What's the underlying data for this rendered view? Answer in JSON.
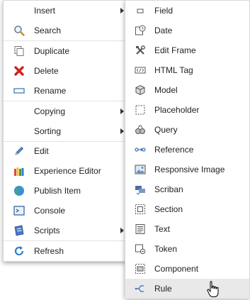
{
  "main_menu": {
    "items": [
      {
        "label": "Insert",
        "icon": "none",
        "submenu": true
      },
      {
        "label": "Search",
        "icon": "magnifier-icon",
        "submenu": false
      },
      {
        "label": "Duplicate",
        "icon": "duplicate-icon",
        "submenu": false
      },
      {
        "label": "Delete",
        "icon": "red-x-icon",
        "submenu": false
      },
      {
        "label": "Rename",
        "icon": "rename-field-icon",
        "submenu": false
      },
      {
        "label": "Copying",
        "icon": "none",
        "submenu": true
      },
      {
        "label": "Sorting",
        "icon": "none",
        "submenu": true
      },
      {
        "label": "Edit",
        "icon": "pencil-icon",
        "submenu": false
      },
      {
        "label": "Experience Editor",
        "icon": "crayons-icon",
        "submenu": false
      },
      {
        "label": "Publish Item",
        "icon": "globe-icon",
        "submenu": false
      },
      {
        "label": "Console",
        "icon": "console-icon",
        "submenu": false
      },
      {
        "label": "Scripts",
        "icon": "scripts-icon",
        "submenu": true
      },
      {
        "label": "Refresh",
        "icon": "refresh-icon",
        "submenu": false
      }
    ]
  },
  "sub_menu": {
    "items": [
      {
        "label": "Field",
        "icon": "field-icon"
      },
      {
        "label": "Date",
        "icon": "date-icon"
      },
      {
        "label": "Edit Frame",
        "icon": "tools-icon"
      },
      {
        "label": "HTML Tag",
        "icon": "html-tag-icon"
      },
      {
        "label": "Model",
        "icon": "cube-icon"
      },
      {
        "label": "Placeholder",
        "icon": "placeholder-icon"
      },
      {
        "label": "Query",
        "icon": "query-icon"
      },
      {
        "label": "Reference",
        "icon": "reference-icon"
      },
      {
        "label": "Responsive Image",
        "icon": "image-icon"
      },
      {
        "label": "Scriban",
        "icon": "scriban-icon"
      },
      {
        "label": "Section",
        "icon": "section-icon"
      },
      {
        "label": "Text",
        "icon": "text-icon"
      },
      {
        "label": "Token",
        "icon": "token-icon"
      },
      {
        "label": "Component",
        "icon": "component-icon"
      },
      {
        "label": "Rule",
        "icon": "rule-icon",
        "highlighted": true
      }
    ]
  }
}
